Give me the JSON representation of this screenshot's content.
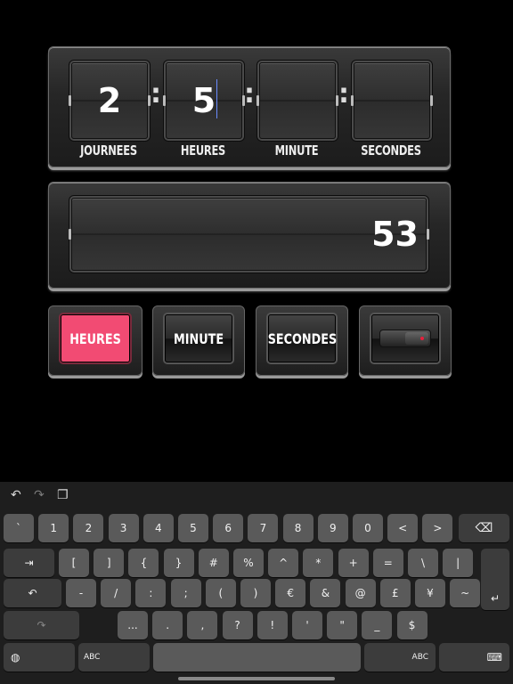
{
  "countdown": {
    "units": [
      {
        "value": "2",
        "label": "JOURNEES"
      },
      {
        "value": "5",
        "label": "HEURES"
      },
      {
        "value": "",
        "label": "MINUTE"
      },
      {
        "value": "",
        "label": "SECONDES"
      }
    ],
    "separator": ":"
  },
  "result": {
    "value": "53"
  },
  "modes": [
    {
      "label": "HEURES",
      "active": true
    },
    {
      "label": "MINUTE",
      "active": false
    },
    {
      "label": "SECONDES",
      "active": false
    },
    {
      "label": "",
      "toggle": true
    }
  ],
  "colors": {
    "accent": "#f24b73",
    "toggle_dot": "#e8203c"
  },
  "keyboard": {
    "toolbar": [
      "undo-icon",
      "redo-icon",
      "paste-icon"
    ],
    "row1": [
      "`",
      "1",
      "2",
      "3",
      "4",
      "5",
      "6",
      "7",
      "8",
      "9",
      "0",
      "<",
      ">"
    ],
    "row1_end": "delete-icon",
    "row2_start": "tab-icon",
    "row2": [
      "[",
      "]",
      "{",
      "}",
      "#",
      "%",
      "^",
      "*",
      "+",
      "=",
      "\\",
      "|"
    ],
    "row3_start": "undo-key-icon",
    "row3": [
      "-",
      "/",
      ":",
      ";",
      "(",
      ")",
      "€",
      "&",
      "@",
      "£",
      "¥",
      "~"
    ],
    "row3_end": "return-icon",
    "row4_start": "redo-key-icon",
    "row4": [
      "...",
      ".",
      ",",
      "?",
      "!",
      "'",
      "\"",
      "_",
      "$"
    ],
    "row5": {
      "globe": "globe-icon",
      "abc_left": "ABC",
      "abc_right": "ABC",
      "dismiss": "keyboard-dismiss-icon"
    }
  }
}
